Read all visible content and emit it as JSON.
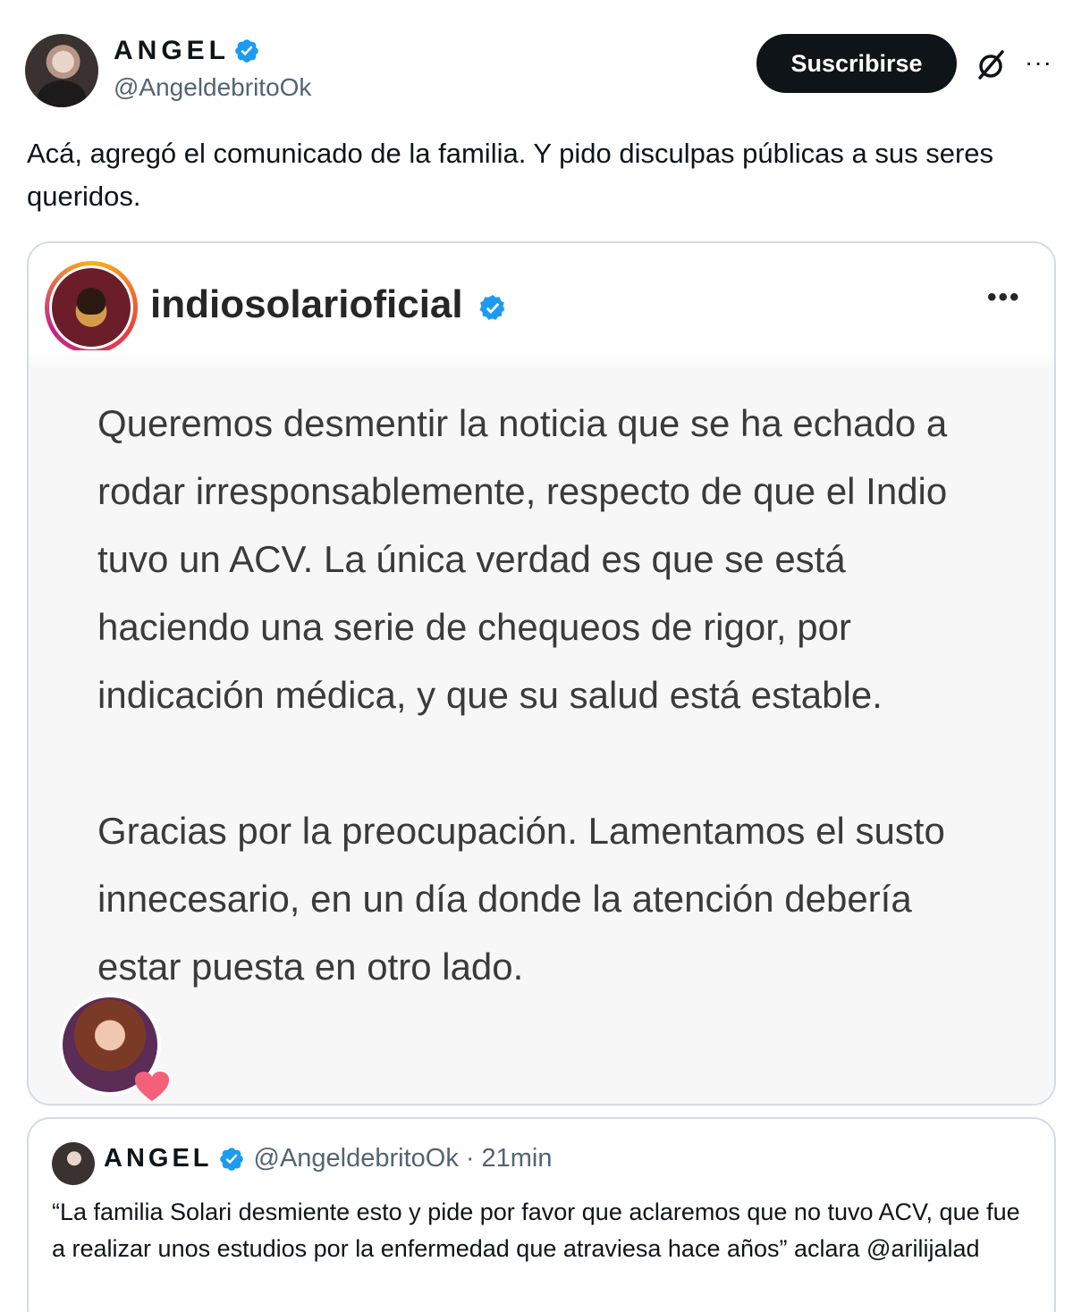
{
  "author": {
    "display_name": "ANGEL",
    "handle": "@AngeldebritoOk"
  },
  "actions": {
    "subscribe_label": "Suscribirse",
    "grok_icon": "grok-slash-icon",
    "more_icon": "more-horizontal-icon",
    "more_glyph": "···"
  },
  "tweet": {
    "text": "Acá, agregó el comunicado de la familia. Y pido disculpas públicas a sus seres queridos."
  },
  "media": {
    "account_name": "indiosolarioficial",
    "more_glyph": "•••",
    "statement_paragraphs": [
      "Queremos desmentir la noticia que se ha echado a rodar irresponsablemente, respecto de que el Indio tuvo un ACV. La única verdad es que se está haciendo una serie de chequeos de rigor, por indicación médica, y que su salud está estable.",
      "Gracias por la preocupación. Lamentamos el susto innecesario, en un día donde la atención debería estar puesta en otro lado."
    ]
  },
  "quoted": {
    "display_name": "ANGEL",
    "handle": "@AngeldebritoOk",
    "separator": "·",
    "time": "21min",
    "text": "“La familia Solari desmiente esto y pide por favor que aclaremos que no tuvo ACV, que fue a realizar unos estudios por la enfermedad que atraviesa hace años” aclara @arilijalad"
  },
  "colors": {
    "verified_blue": "#1d9bf0",
    "text_primary": "#0f1419",
    "text_secondary": "#536471",
    "button_dark": "#0f1419"
  }
}
